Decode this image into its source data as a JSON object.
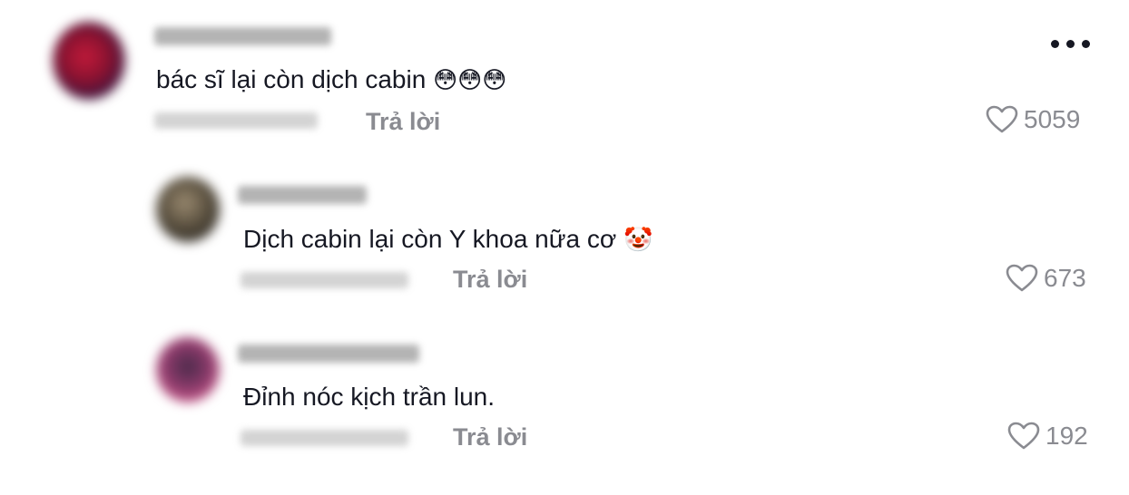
{
  "comments": [
    {
      "text": "bác sĩ lại còn dịch cabin",
      "emoji": "😳😳😳",
      "reply_label": "Trả lời",
      "likes": "5059",
      "icon": "heart-outline-icon"
    },
    {
      "text": "Dịch cabin lại còn Y khoa nữa cơ",
      "emoji": "🤡",
      "reply_label": "Trả lời",
      "likes": "673",
      "icon": "heart-outline-icon"
    },
    {
      "text": "Đỉnh nóc kịch trần lun.",
      "emoji": "",
      "reply_label": "Trả lời",
      "likes": "192",
      "icon": "heart-outline-icon"
    }
  ],
  "more_icon": "more-horizontal-icon"
}
